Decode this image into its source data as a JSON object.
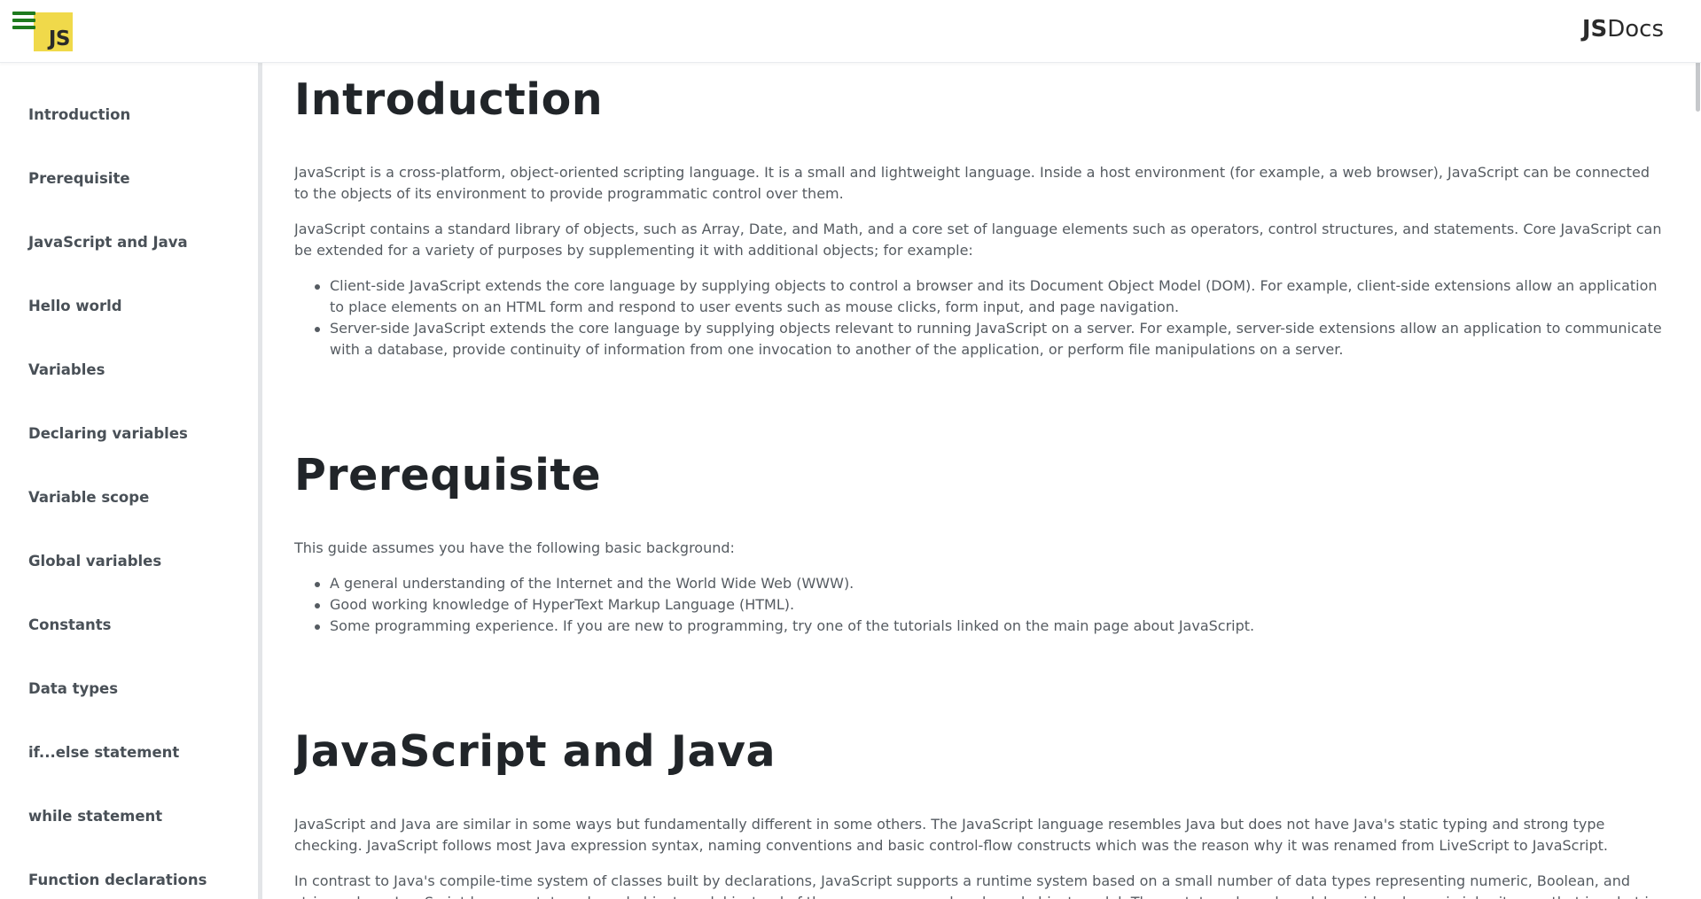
{
  "header": {
    "menu_icon": "hamburger-menu-icon",
    "logo_text": "JS",
    "logo_color": "#f0d94a",
    "brand_bold": "JS",
    "brand_light": "Docs"
  },
  "sidebar": {
    "items": [
      {
        "label": "Introduction"
      },
      {
        "label": "Prerequisite"
      },
      {
        "label": "JavaScript and Java"
      },
      {
        "label": "Hello world"
      },
      {
        "label": "Variables"
      },
      {
        "label": "Declaring variables"
      },
      {
        "label": "Variable scope"
      },
      {
        "label": "Global variables"
      },
      {
        "label": "Constants"
      },
      {
        "label": "Data types"
      },
      {
        "label": "if...else statement"
      },
      {
        "label": "while statement"
      },
      {
        "label": "Function declarations"
      }
    ]
  },
  "sections": {
    "introduction": {
      "title": "Introduction",
      "p1": "JavaScript is a cross-platform, object-oriented scripting language. It is a small and lightweight language. Inside a host environment (for example, a web browser), JavaScript can be connected to the objects of its environment to provide programmatic control over them.",
      "p2": "JavaScript contains a standard library of objects, such as Array, Date, and Math, and a core set of language elements such as operators, control structures, and statements. Core JavaScript can be extended for a variety of purposes by supplementing it with additional objects; for example:",
      "bullets": [
        "Client-side JavaScript extends the core language by supplying objects to control a browser and its Document Object Model (DOM). For example, client-side extensions allow an application to place elements on an HTML form and respond to user events such as mouse clicks, form input, and page navigation.",
        "Server-side JavaScript extends the core language by supplying objects relevant to running JavaScript on a server. For example, server-side extensions allow an application to communicate with a database, provide continuity of information from one invocation to another of the application, or perform file manipulations on a server."
      ]
    },
    "prerequisite": {
      "title": "Prerequisite",
      "p1": "This guide assumes you have the following basic background:",
      "bullets": [
        "A general understanding of the Internet and the World Wide Web (WWW).",
        "Good working knowledge of HyperText Markup Language (HTML).",
        "Some programming experience. If you are new to programming, try one of the tutorials linked on the main page about JavaScript."
      ]
    },
    "javascript_and_java": {
      "title": "JavaScript and Java",
      "p1": "JavaScript and Java are similar in some ways but fundamentally different in some others. The JavaScript language resembles Java but does not have Java's static typing and strong type checking. JavaScript follows most Java expression syntax, naming conventions and basic control-flow constructs which was the reason why it was renamed from LiveScript to JavaScript.",
      "p2": "In contrast to Java's compile-time system of classes built by declarations, JavaScript supports a runtime system based on a small number of data types representing numeric, Boolean, and string values. JavaScript has a prototype-based object model instead of the more common class-based object model. The prototype-based model provides dynamic inheritance; that is, what is"
    }
  }
}
